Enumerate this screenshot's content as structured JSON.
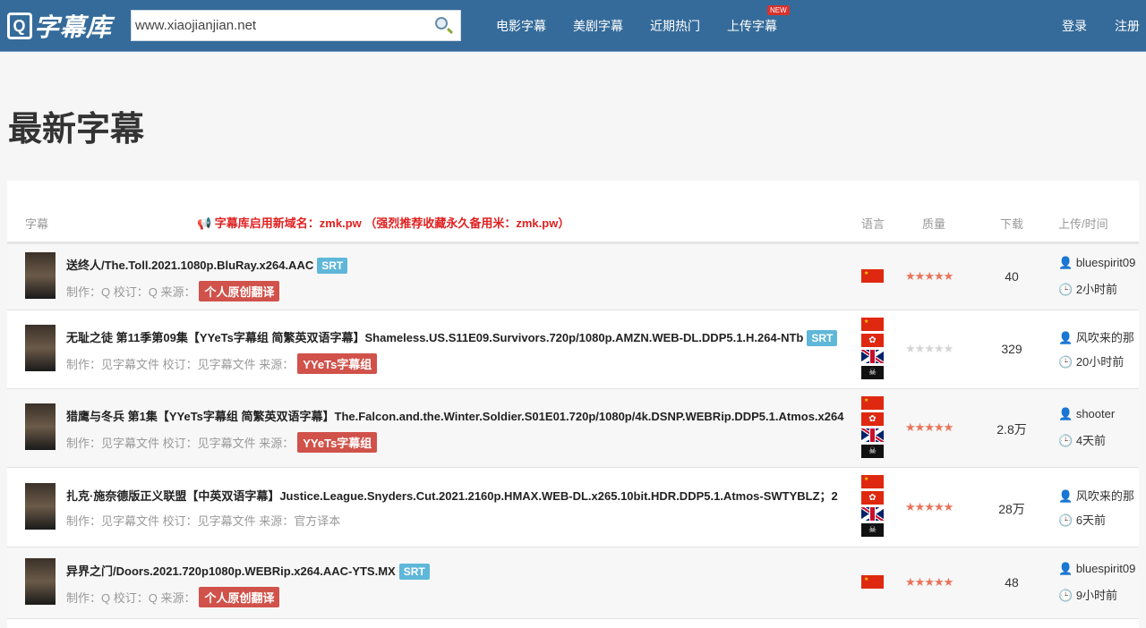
{
  "header": {
    "logo": "字幕库",
    "logo_badge": "Q",
    "search_value": "www.xiaojianjian.net",
    "nav": [
      "电影字幕",
      "美剧字幕",
      "近期热门",
      "上传字幕"
    ],
    "new_badge": "NEW",
    "login": "登录",
    "register": "注册",
    "brand_color": "#356b9a"
  },
  "page_title": "最新字幕",
  "table": {
    "col_subtitle": "字幕",
    "notice": "📢 字幕库启用新域名：zmk.pw （强烈推荐收藏永久备用米：zmk.pw）",
    "col_lang": "语言",
    "col_quality": "质量",
    "col_downloads": "下载",
    "col_upload": "上传/时间",
    "rows": [
      {
        "title": "送终人/The.Toll.2021.1080p.BluRay.x264.AAC",
        "format": "SRT",
        "meta": "制作：Q 校订：Q 来源：",
        "source": "个人原创翻译",
        "source_tag": true,
        "langs": [
          "cn"
        ],
        "rating": 5,
        "downloads": "40",
        "uploader": "bluespirit09",
        "time": "2小时前"
      },
      {
        "title": "无耻之徒 第11季第09集【YYeTs字幕组 简繁英双语字幕】Shameless.US.S11E09.Survivors.720p/1080p.AMZN.WEB-DL.DDP5.1.H.264-NTb",
        "format": "SRT",
        "meta": "制作：见字幕文件 校订：见字幕文件 来源：",
        "source": "YYeTs字幕组",
        "source_tag": true,
        "langs": [
          "cn",
          "hk",
          "uk",
          "pirate"
        ],
        "rating": 0,
        "downloads": "329",
        "uploader": "风吹来的那",
        "time": "20小时前"
      },
      {
        "title": "猎鹰与冬兵 第1集【YYeTs字幕组 简繁英双语字幕】The.Falcon.and.the.Winter.Soldier.S01E01.720p/1080p/4k.DSNP.WEBRip.DDP5.1.Atmos.x264",
        "format": "",
        "meta": "制作：见字幕文件 校订：见字幕文件 来源：",
        "source": "YYeTs字幕组",
        "source_tag": true,
        "langs": [
          "cn",
          "hk",
          "uk",
          "pirate"
        ],
        "rating": 5,
        "downloads": "2.8万",
        "uploader": "shooter",
        "time": "4天前"
      },
      {
        "title": "扎克·施奈德版正义联盟【中英双语字幕】Justice.League.Snyders.Cut.2021.2160p.HMAX.WEB-DL.x265.10bit.HDR.DDP5.1.Atmos-SWTYBLZ；2",
        "format": "",
        "meta": "制作：见字幕文件 校订：见字幕文件 来源：",
        "source": "官方译本",
        "source_tag": false,
        "langs": [
          "cn",
          "hk",
          "uk",
          "pirate"
        ],
        "rating": 5,
        "downloads": "28万",
        "uploader": "风吹来的那",
        "time": "6天前"
      },
      {
        "title": "异界之门/Doors.2021.720p1080p.WEBRip.x264.AAC-YTS.MX",
        "format": "SRT",
        "meta": "制作：Q 校订：Q 来源：",
        "source": "个人原创翻译",
        "source_tag": true,
        "langs": [
          "cn"
        ],
        "rating": 5,
        "downloads": "48",
        "uploader": "bluespirit09",
        "time": "9小时前"
      }
    ]
  },
  "colors": {
    "star_on": "#e8745a",
    "star_off": "#d5d5d5",
    "tag": "#d0524a",
    "srt": "#5fb7d9",
    "notice": "#e02020"
  }
}
